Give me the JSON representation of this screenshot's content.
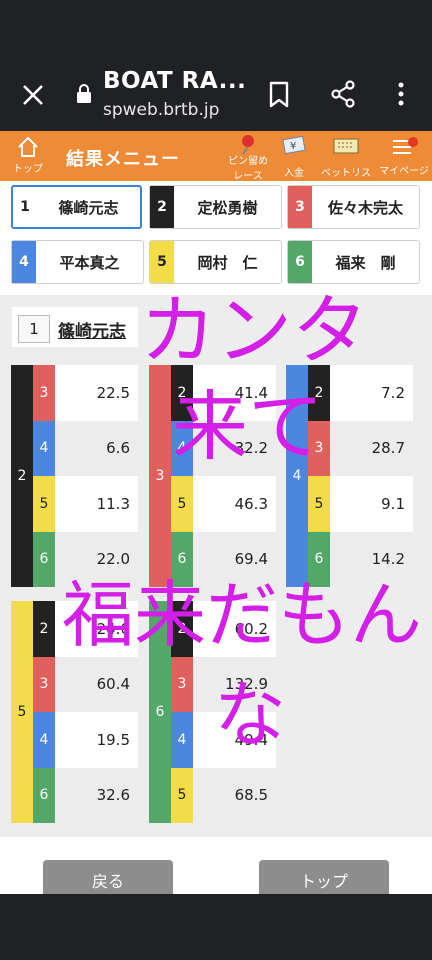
{
  "browser": {
    "title": "BOAT RA...",
    "host": "spweb.brtb.jp"
  },
  "nav": {
    "top_label": "トップ",
    "menu_title": "結果メニュー",
    "pin_label_1": "ピン留め",
    "pin_label_2": "レース",
    "deposit_label": "入金",
    "betlist_label": "ベットリスト",
    "mypage_label": "マイページ"
  },
  "racers": [
    {
      "num": "1",
      "name": "篠崎元志",
      "color": "#ffffff"
    },
    {
      "num": "2",
      "name": "定松勇樹",
      "color": "#222222"
    },
    {
      "num": "3",
      "name": "佐々木完太",
      "color": "#e0605e"
    },
    {
      "num": "4",
      "name": "平本真之",
      "color": "#4b86e0"
    },
    {
      "num": "5",
      "name": "岡村　仁",
      "color": "#f3dc4a"
    },
    {
      "num": "6",
      "name": "福来　剛",
      "color": "#53a869"
    }
  ],
  "selected": {
    "num": "1",
    "name": "篠崎元志"
  },
  "odds": [
    {
      "first": "2",
      "rows": [
        {
          "second": "3",
          "odds": "22.5"
        },
        {
          "second": "4",
          "odds": "6.6"
        },
        {
          "second": "5",
          "odds": "11.3"
        },
        {
          "second": "6",
          "odds": "22.0"
        }
      ]
    },
    {
      "first": "3",
      "rows": [
        {
          "second": "2",
          "odds": "41.4"
        },
        {
          "second": "4",
          "odds": "32.2"
        },
        {
          "second": "5",
          "odds": "46.3"
        },
        {
          "second": "6",
          "odds": "69.4"
        }
      ]
    },
    {
      "first": "4",
      "rows": [
        {
          "second": "2",
          "odds": "7.2"
        },
        {
          "second": "3",
          "odds": "28.7"
        },
        {
          "second": "5",
          "odds": "9.1"
        },
        {
          "second": "6",
          "odds": "14.2"
        }
      ]
    },
    {
      "first": "5",
      "rows": [
        {
          "second": "2",
          "odds": "24.0"
        },
        {
          "second": "3",
          "odds": "60.4"
        },
        {
          "second": "4",
          "odds": "19.5"
        },
        {
          "second": "6",
          "odds": "32.6"
        }
      ]
    },
    {
      "first": "6",
      "rows": [
        {
          "second": "2",
          "odds": "60.2"
        },
        {
          "second": "3",
          "odds": "132.9"
        },
        {
          "second": "4",
          "odds": "49.4"
        },
        {
          "second": "5",
          "odds": "68.5"
        }
      ]
    }
  ],
  "overlay": {
    "line1": "カンタ",
    "line2": "来て",
    "line3": "福来だもん",
    "line4": "な"
  },
  "buttons": {
    "back": "戻る",
    "top": "トップ"
  }
}
